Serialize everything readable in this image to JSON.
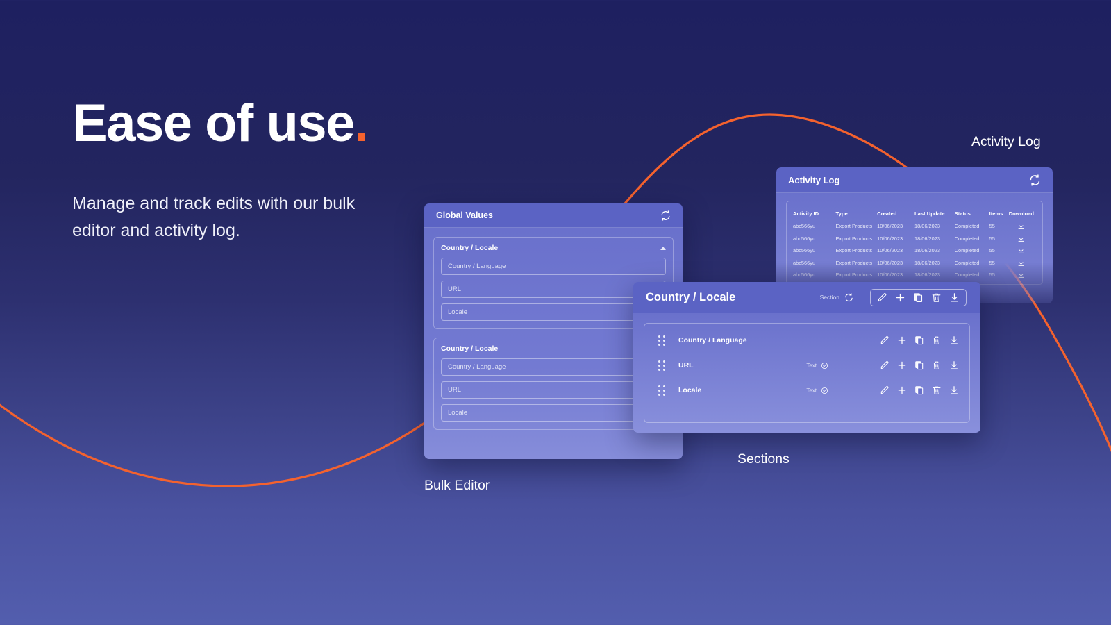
{
  "theme": {
    "bg_top": "#1e2060",
    "bg_bottom": "#535eae",
    "accent_orange": "#f4622e",
    "panel_header": "#5b63c4",
    "panel_body": "#6a71cc"
  },
  "hero": {
    "title": "Ease of use",
    "title_dot": ".",
    "subtitle": "Manage and track edits with our bulk editor and activity log."
  },
  "annotations": {
    "activity_log": "Activity Log",
    "sections": "Sections",
    "bulk_editor": "Bulk Editor"
  },
  "bulk_editor": {
    "title": "Global Values",
    "refresh_icon": "refresh-icon",
    "sections": [
      {
        "title": "Country / Locale",
        "collapse_icon": "chevron-up-icon",
        "fields": [
          {
            "placeholder": "Country / Language"
          },
          {
            "placeholder": "URL"
          },
          {
            "placeholder": "Locale"
          }
        ]
      },
      {
        "title": "Country / Locale",
        "collapse_icon": "chevron-up-icon",
        "fields": [
          {
            "placeholder": "Country / Language"
          },
          {
            "placeholder": "URL"
          },
          {
            "placeholder": "Locale"
          }
        ]
      }
    ]
  },
  "activity_log": {
    "title": "Activity Log",
    "refresh_icon": "refresh-icon",
    "columns": [
      "Activity ID",
      "Type",
      "Created",
      "Last Update",
      "Status",
      "Items",
      "Download"
    ],
    "rows": [
      {
        "activity_id": "abc566yu",
        "type": "Export Products",
        "created": "10/06/2023",
        "last_update": "18/06/2023",
        "status": "Completed",
        "items": "55",
        "download_icon": "download-icon"
      },
      {
        "activity_id": "abc566yu",
        "type": "Export Products",
        "created": "10/06/2023",
        "last_update": "18/06/2023",
        "status": "Completed",
        "items": "55",
        "download_icon": "download-icon"
      },
      {
        "activity_id": "abc566yu",
        "type": "Export Products",
        "created": "10/06/2023",
        "last_update": "18/06/2023",
        "status": "Completed",
        "items": "55",
        "download_icon": "download-icon"
      },
      {
        "activity_id": "abc566yu",
        "type": "Export Products",
        "created": "10/06/2023",
        "last_update": "18/06/2023",
        "status": "Completed",
        "items": "55",
        "download_icon": "download-icon"
      },
      {
        "activity_id": "abc566yu",
        "type": "Export Products",
        "created": "10/06/2023",
        "last_update": "18/06/2023",
        "status": "Completed",
        "items": "55",
        "download_icon": "download-icon"
      }
    ]
  },
  "sections_panel": {
    "title": "Country / Locale",
    "meta_label": "Section",
    "meta_refresh_icon": "refresh-icon",
    "toolbar": [
      {
        "icon": "edit-pencil-icon"
      },
      {
        "icon": "plus-icon"
      },
      {
        "icon": "copy-icon"
      },
      {
        "icon": "trash-icon"
      },
      {
        "icon": "download-icon"
      }
    ],
    "rows": [
      {
        "label": "Country / Language",
        "type": "",
        "type_check": false
      },
      {
        "label": "URL",
        "type": "Text",
        "type_check": true
      },
      {
        "label": "Locale",
        "type": "Text",
        "type_check": true
      }
    ]
  }
}
